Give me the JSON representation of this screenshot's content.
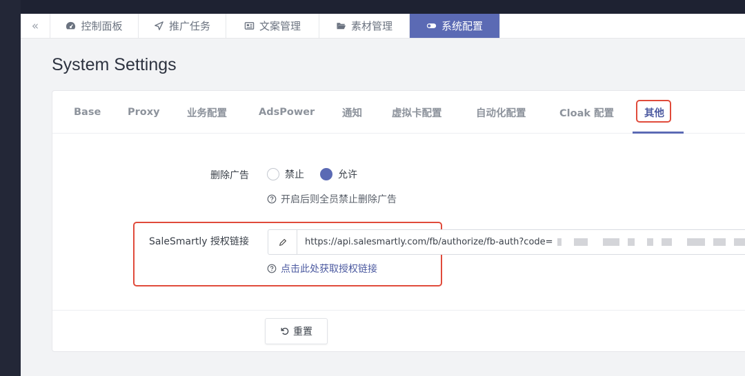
{
  "nav": {
    "collapse_icon": "double-chevron-left-icon",
    "tabs": [
      {
        "label": "控制面板",
        "icon": "dashboard-icon"
      },
      {
        "label": "推广任务",
        "icon": "send-icon"
      },
      {
        "label": "文案管理",
        "icon": "newspaper-icon"
      },
      {
        "label": "素材管理",
        "icon": "folder-open-icon"
      },
      {
        "label": "系统配置",
        "icon": "toggle-icon",
        "active": true
      }
    ]
  },
  "page": {
    "title": "System Settings"
  },
  "settings_tabs": [
    {
      "label": "Base"
    },
    {
      "label": "Proxy"
    },
    {
      "label": "业务配置"
    },
    {
      "label": "AdsPower"
    },
    {
      "label": "通知"
    },
    {
      "label": "虚拟卡配置"
    },
    {
      "label": "自动化配置"
    },
    {
      "label": "Cloak 配置"
    },
    {
      "label": "其他",
      "active": true
    }
  ],
  "form": {
    "delete_ads": {
      "label": "删除广告",
      "options": [
        {
          "label": "禁止",
          "checked": false
        },
        {
          "label": "允许",
          "checked": true
        }
      ],
      "help": "开启后则全员禁止删除广告"
    },
    "salesmartly": {
      "label": "SaleSmartly 授权链接",
      "value": "https://api.salesmartly.com/fb/authorize/fb-auth?code=",
      "help_link": "点击此处获取授权链接"
    }
  },
  "actions": {
    "reset_label": "重置"
  },
  "colors": {
    "accent": "#5b6ab4",
    "highlight": "#e04a3a",
    "sidebar": "#232737"
  }
}
